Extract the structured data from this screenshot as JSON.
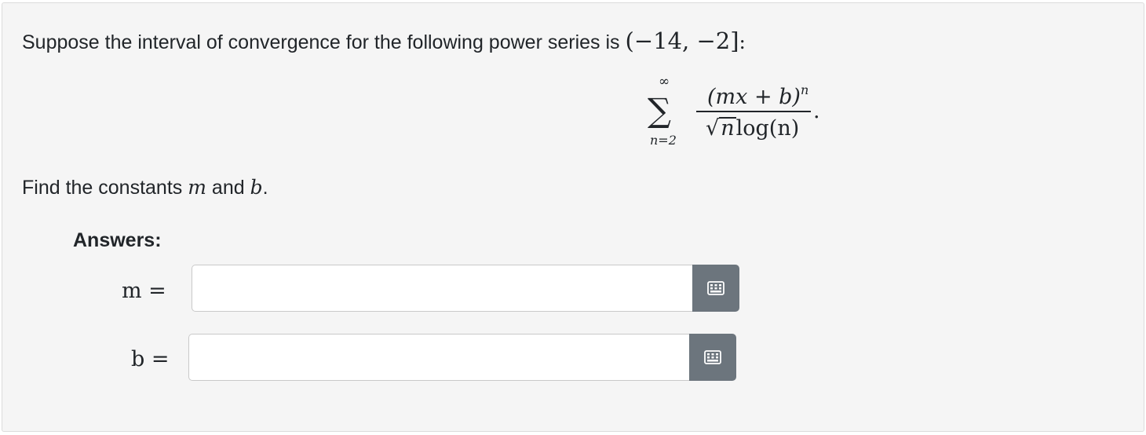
{
  "question": {
    "prompt_text": "Suppose the interval of convergence for the following power series is",
    "interval": "(−14, −2]",
    "colon": ":",
    "sum_upper": "∞",
    "sum_lower": "n=2",
    "numerator": "(mx + b)",
    "numerator_exp": "n",
    "denominator_sqrt": "n",
    "denominator_log": "log(n)",
    "find_prefix": "Find the constants",
    "var_m": "m",
    "and_word": "and",
    "var_b": "b",
    "find_suffix": "."
  },
  "answers": {
    "title": "Answers:",
    "fields": [
      {
        "label": "m =",
        "value": "",
        "button_icon": "keyboard-icon"
      },
      {
        "label": "b =",
        "value": "",
        "button_icon": "keyboard-icon"
      }
    ]
  },
  "colors": {
    "card_bg": "#f5f5f5",
    "button_bg": "#6c757d",
    "text": "#212529"
  }
}
